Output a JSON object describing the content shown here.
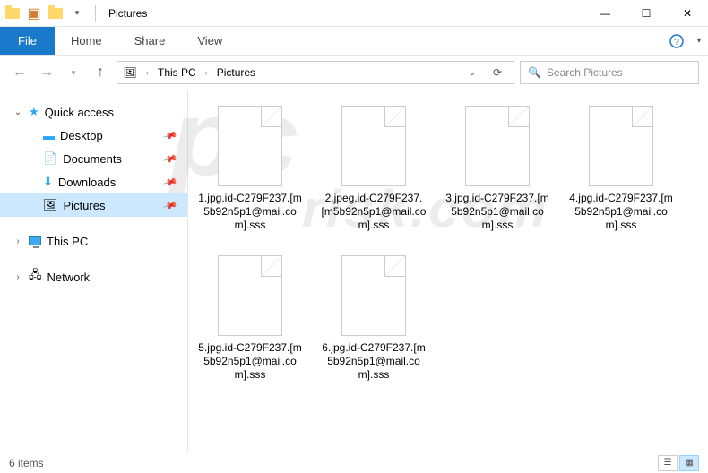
{
  "title": "Pictures",
  "ribbon": {
    "file": "File",
    "tabs": [
      "Home",
      "Share",
      "View"
    ]
  },
  "breadcrumb": {
    "items": [
      "This PC",
      "Pictures"
    ]
  },
  "search": {
    "placeholder": "Search Pictures"
  },
  "quickaccess": {
    "label": "Quick access",
    "items": [
      {
        "label": "Desktop"
      },
      {
        "label": "Documents"
      },
      {
        "label": "Downloads"
      },
      {
        "label": "Pictures",
        "selected": true
      }
    ]
  },
  "nav": {
    "thispc": "This PC",
    "network": "Network"
  },
  "files": [
    {
      "name": "1.jpg.id-C279F237.[m5b92n5p1@mail.com].sss"
    },
    {
      "name": "2.jpeg.id-C279F237.[m5b92n5p1@mail.com].sss"
    },
    {
      "name": "3.jpg.id-C279F237.[m5b92n5p1@mail.com].sss"
    },
    {
      "name": "4.jpg.id-C279F237.[m5b92n5p1@mail.com].sss"
    },
    {
      "name": "5.jpg.id-C279F237.[m5b92n5p1@mail.com].sss"
    },
    {
      "name": "6.jpg.id-C279F237.[m5b92n5p1@mail.com].sss"
    }
  ],
  "status": {
    "count": "6 items"
  },
  "watermark": {
    "line1": "pc",
    "line2": "risk.com"
  }
}
